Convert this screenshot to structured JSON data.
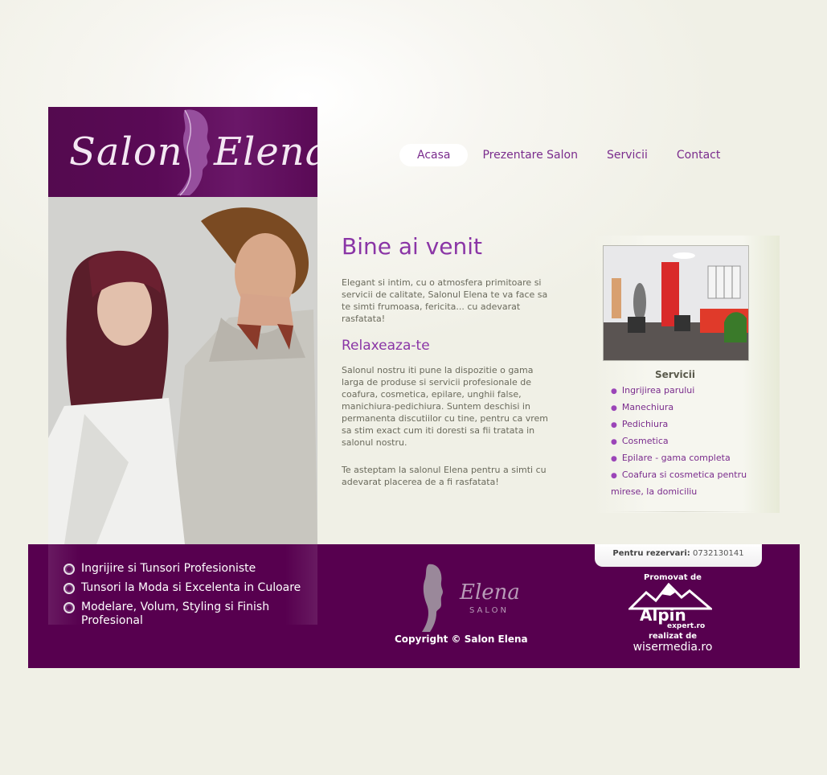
{
  "logo": {
    "word1": "Salon",
    "word2": "Elena"
  },
  "nav": {
    "items": [
      {
        "label": "Acasa",
        "active": true
      },
      {
        "label": "Prezentare Salon",
        "active": false
      },
      {
        "label": "Servicii",
        "active": false
      },
      {
        "label": "Contact",
        "active": false
      }
    ]
  },
  "main": {
    "welcome_title": "Bine ai venit",
    "welcome_text": "Elegant si intim, cu o atmosfera primitoare si servicii de calitate, Salonul Elena te va face sa te simti frumoasa, fericita... cu adevarat rasfatata!",
    "relax_title": "Relaxeaza-te",
    "relax_text": "Salonul nostru iti pune la dispozitie o gama larga de produse si servicii profesionale de coafura, cosmetica, epilare, unghii false, manichiura-pedichiura. Suntem deschisi in permanenta discutiilor cu tine, pentru ca vrem sa stim exact cum iti doresti sa fii tratata in salonul nostru.",
    "closing_text": "Te asteptam la salonul Elena pentru a simti cu adevarat placerea de a fi rasfatata!"
  },
  "services": {
    "title": "Servicii",
    "items": [
      "Ingrijirea parului",
      "Manechiura",
      "Pedichiura",
      "Cosmetica",
      "Epilare - gama completa",
      "Coafura si cosmetica pentru mirese, la domiciliu"
    ]
  },
  "footer": {
    "features": [
      "Ingrijire si Tunsori Profesioniste",
      "Tunsori la Moda si Excelenta in Culoare",
      "Modelare, Volum, Styling si Finish Profesional"
    ],
    "logo_word": "Elena",
    "logo_sub": "SALON",
    "copyright": "Copyright © Salon Elena",
    "booking_label": "Pentru rezervari:",
    "booking_phone": "0732130141",
    "promo_label": "Promovat de",
    "alpin_word": "Alpin",
    "alpin_sub": "expert.ro",
    "made_label": "realizat de",
    "made_by": "wisermedia.ro"
  },
  "colors": {
    "brand_purple": "#57004f",
    "accent_purple": "#8a35a6",
    "link_purple": "#7a2c8d"
  }
}
